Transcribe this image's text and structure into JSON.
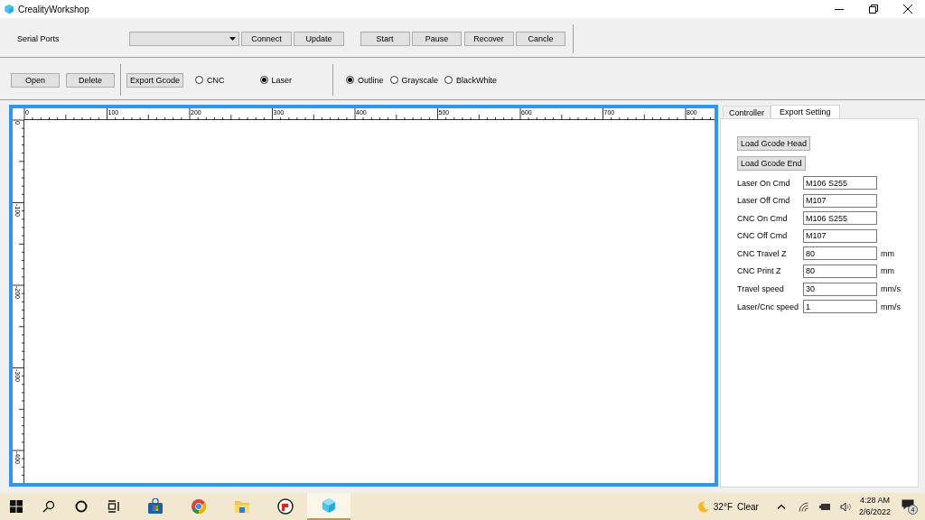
{
  "window": {
    "title": "CrealityWorkshop"
  },
  "serial": {
    "label": "Serial Ports",
    "connect_buttons": [
      "Connect",
      "Update"
    ],
    "job_buttons": [
      "Start",
      "Pause",
      "Recover",
      "Cancle"
    ]
  },
  "file_buttons": [
    "Open",
    "Delete"
  ],
  "export_button": "Export Gcode",
  "mode_options": [
    {
      "label": "CNC",
      "selected": false
    },
    {
      "label": "Laser",
      "selected": true
    }
  ],
  "image_options": [
    {
      "label": "Outline",
      "selected": true
    },
    {
      "label": "Grayscale",
      "selected": false
    },
    {
      "label": "BlackWhite",
      "selected": false
    }
  ],
  "canvas": {
    "x_ruler": [
      "0",
      "100",
      "200",
      "300",
      "400",
      "500",
      "600",
      "700",
      "800"
    ],
    "y_ruler": [
      "0",
      "-100",
      "-200",
      "-300",
      "-400"
    ]
  },
  "panel": {
    "tabs": [
      {
        "label": "Controller",
        "selected": false
      },
      {
        "label": "Export Setting",
        "selected": true
      }
    ],
    "load_buttons": [
      "Load Gcode Head",
      "Load Gcode End"
    ],
    "fields": [
      {
        "label": "Laser On Cmd",
        "value": "M106 S255"
      },
      {
        "label": "Laser Off Cmd",
        "value": "M107"
      },
      {
        "label": "CNC On Cmd",
        "value": "M106 S255"
      },
      {
        "label": "CNC Off Cmd",
        "value": "M107"
      },
      {
        "label": "CNC Travel Z",
        "value": "80",
        "unit": "mm"
      },
      {
        "label": "CNC Print Z",
        "value": "80",
        "unit": "mm"
      },
      {
        "label": "Travel speed",
        "value": "30",
        "unit": "mm/s"
      },
      {
        "label": "Laser/Cnc speed",
        "value": "1",
        "unit": "mm/s"
      }
    ]
  },
  "taskbar": {
    "apps": [
      {
        "kind": "start",
        "selected": false
      },
      {
        "kind": "search",
        "selected": false
      },
      {
        "kind": "cortana",
        "selected": false
      },
      {
        "kind": "taskview",
        "selected": false
      },
      {
        "kind": "store",
        "selected": false
      },
      {
        "kind": "browser",
        "selected": false
      },
      {
        "kind": "folder",
        "selected": false
      },
      {
        "kind": "reader",
        "selected": false
      },
      {
        "kind": "cube",
        "selected": true
      }
    ],
    "weather": {
      "temperature": "32°F",
      "condition": "Clear"
    },
    "time": "4:28 AM",
    "date": "2/6/2022",
    "notifications": "4"
  }
}
